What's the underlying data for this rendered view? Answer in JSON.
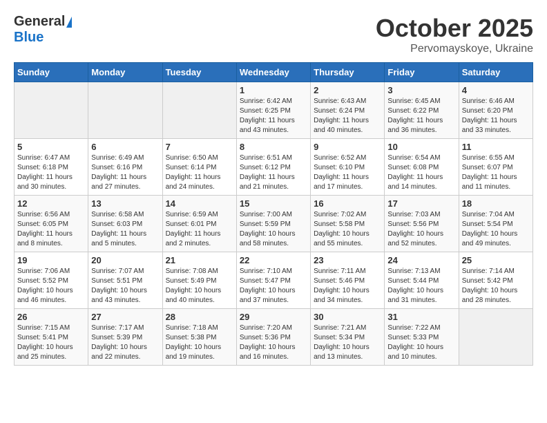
{
  "header": {
    "logo_general": "General",
    "logo_blue": "Blue",
    "month_year": "October 2025",
    "location": "Pervomayskoye, Ukraine"
  },
  "weekdays": [
    "Sunday",
    "Monday",
    "Tuesday",
    "Wednesday",
    "Thursday",
    "Friday",
    "Saturday"
  ],
  "weeks": [
    [
      {
        "day": "",
        "info": ""
      },
      {
        "day": "",
        "info": ""
      },
      {
        "day": "",
        "info": ""
      },
      {
        "day": "1",
        "info": "Sunrise: 6:42 AM\nSunset: 6:25 PM\nDaylight: 11 hours\nand 43 minutes."
      },
      {
        "day": "2",
        "info": "Sunrise: 6:43 AM\nSunset: 6:24 PM\nDaylight: 11 hours\nand 40 minutes."
      },
      {
        "day": "3",
        "info": "Sunrise: 6:45 AM\nSunset: 6:22 PM\nDaylight: 11 hours\nand 36 minutes."
      },
      {
        "day": "4",
        "info": "Sunrise: 6:46 AM\nSunset: 6:20 PM\nDaylight: 11 hours\nand 33 minutes."
      }
    ],
    [
      {
        "day": "5",
        "info": "Sunrise: 6:47 AM\nSunset: 6:18 PM\nDaylight: 11 hours\nand 30 minutes."
      },
      {
        "day": "6",
        "info": "Sunrise: 6:49 AM\nSunset: 6:16 PM\nDaylight: 11 hours\nand 27 minutes."
      },
      {
        "day": "7",
        "info": "Sunrise: 6:50 AM\nSunset: 6:14 PM\nDaylight: 11 hours\nand 24 minutes."
      },
      {
        "day": "8",
        "info": "Sunrise: 6:51 AM\nSunset: 6:12 PM\nDaylight: 11 hours\nand 21 minutes."
      },
      {
        "day": "9",
        "info": "Sunrise: 6:52 AM\nSunset: 6:10 PM\nDaylight: 11 hours\nand 17 minutes."
      },
      {
        "day": "10",
        "info": "Sunrise: 6:54 AM\nSunset: 6:08 PM\nDaylight: 11 hours\nand 14 minutes."
      },
      {
        "day": "11",
        "info": "Sunrise: 6:55 AM\nSunset: 6:07 PM\nDaylight: 11 hours\nand 11 minutes."
      }
    ],
    [
      {
        "day": "12",
        "info": "Sunrise: 6:56 AM\nSunset: 6:05 PM\nDaylight: 11 hours\nand 8 minutes."
      },
      {
        "day": "13",
        "info": "Sunrise: 6:58 AM\nSunset: 6:03 PM\nDaylight: 11 hours\nand 5 minutes."
      },
      {
        "day": "14",
        "info": "Sunrise: 6:59 AM\nSunset: 6:01 PM\nDaylight: 11 hours\nand 2 minutes."
      },
      {
        "day": "15",
        "info": "Sunrise: 7:00 AM\nSunset: 5:59 PM\nDaylight: 10 hours\nand 58 minutes."
      },
      {
        "day": "16",
        "info": "Sunrise: 7:02 AM\nSunset: 5:58 PM\nDaylight: 10 hours\nand 55 minutes."
      },
      {
        "day": "17",
        "info": "Sunrise: 7:03 AM\nSunset: 5:56 PM\nDaylight: 10 hours\nand 52 minutes."
      },
      {
        "day": "18",
        "info": "Sunrise: 7:04 AM\nSunset: 5:54 PM\nDaylight: 10 hours\nand 49 minutes."
      }
    ],
    [
      {
        "day": "19",
        "info": "Sunrise: 7:06 AM\nSunset: 5:52 PM\nDaylight: 10 hours\nand 46 minutes."
      },
      {
        "day": "20",
        "info": "Sunrise: 7:07 AM\nSunset: 5:51 PM\nDaylight: 10 hours\nand 43 minutes."
      },
      {
        "day": "21",
        "info": "Sunrise: 7:08 AM\nSunset: 5:49 PM\nDaylight: 10 hours\nand 40 minutes."
      },
      {
        "day": "22",
        "info": "Sunrise: 7:10 AM\nSunset: 5:47 PM\nDaylight: 10 hours\nand 37 minutes."
      },
      {
        "day": "23",
        "info": "Sunrise: 7:11 AM\nSunset: 5:46 PM\nDaylight: 10 hours\nand 34 minutes."
      },
      {
        "day": "24",
        "info": "Sunrise: 7:13 AM\nSunset: 5:44 PM\nDaylight: 10 hours\nand 31 minutes."
      },
      {
        "day": "25",
        "info": "Sunrise: 7:14 AM\nSunset: 5:42 PM\nDaylight: 10 hours\nand 28 minutes."
      }
    ],
    [
      {
        "day": "26",
        "info": "Sunrise: 7:15 AM\nSunset: 5:41 PM\nDaylight: 10 hours\nand 25 minutes."
      },
      {
        "day": "27",
        "info": "Sunrise: 7:17 AM\nSunset: 5:39 PM\nDaylight: 10 hours\nand 22 minutes."
      },
      {
        "day": "28",
        "info": "Sunrise: 7:18 AM\nSunset: 5:38 PM\nDaylight: 10 hours\nand 19 minutes."
      },
      {
        "day": "29",
        "info": "Sunrise: 7:20 AM\nSunset: 5:36 PM\nDaylight: 10 hours\nand 16 minutes."
      },
      {
        "day": "30",
        "info": "Sunrise: 7:21 AM\nSunset: 5:34 PM\nDaylight: 10 hours\nand 13 minutes."
      },
      {
        "day": "31",
        "info": "Sunrise: 7:22 AM\nSunset: 5:33 PM\nDaylight: 10 hours\nand 10 minutes."
      },
      {
        "day": "",
        "info": ""
      }
    ]
  ]
}
